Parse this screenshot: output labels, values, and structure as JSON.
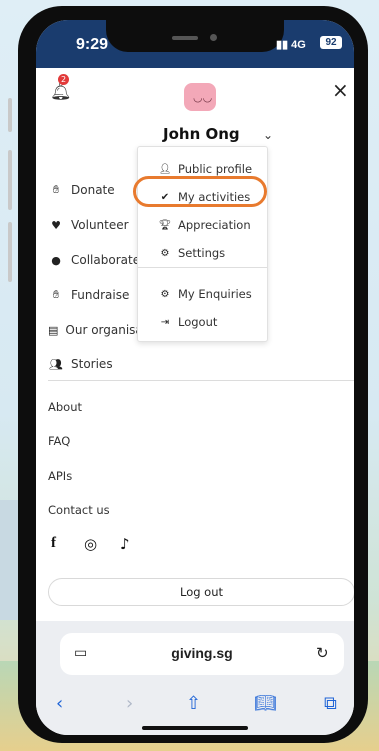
{
  "status": {
    "time": "9:29",
    "signal": "4G",
    "battery": "92"
  },
  "header": {
    "notification_count": "2",
    "user_name": "John Ong",
    "close_label": "×"
  },
  "nav_menu": [
    {
      "label": "Donate"
    },
    {
      "label": "Volunteer"
    },
    {
      "label": "Collaborate"
    },
    {
      "label": "Fundraise"
    },
    {
      "label": "Our organisations"
    },
    {
      "label": "Stories"
    }
  ],
  "user_dropdown": [
    {
      "label": "Public profile"
    },
    {
      "label": "My activities"
    },
    {
      "label": "Appreciation"
    },
    {
      "label": "Settings"
    },
    {
      "label": "My Enquiries"
    },
    {
      "label": "Logout"
    }
  ],
  "footer_links": [
    {
      "label": "About"
    },
    {
      "label": "FAQ"
    },
    {
      "label": "APIs"
    },
    {
      "label": "Contact us"
    }
  ],
  "logout_button": "Log out",
  "browser": {
    "url": "giving.sg"
  },
  "colors": {
    "status_bar": "#1a3c6e",
    "highlight": "#e87a2e",
    "safari_blue": "#1e63d6"
  }
}
